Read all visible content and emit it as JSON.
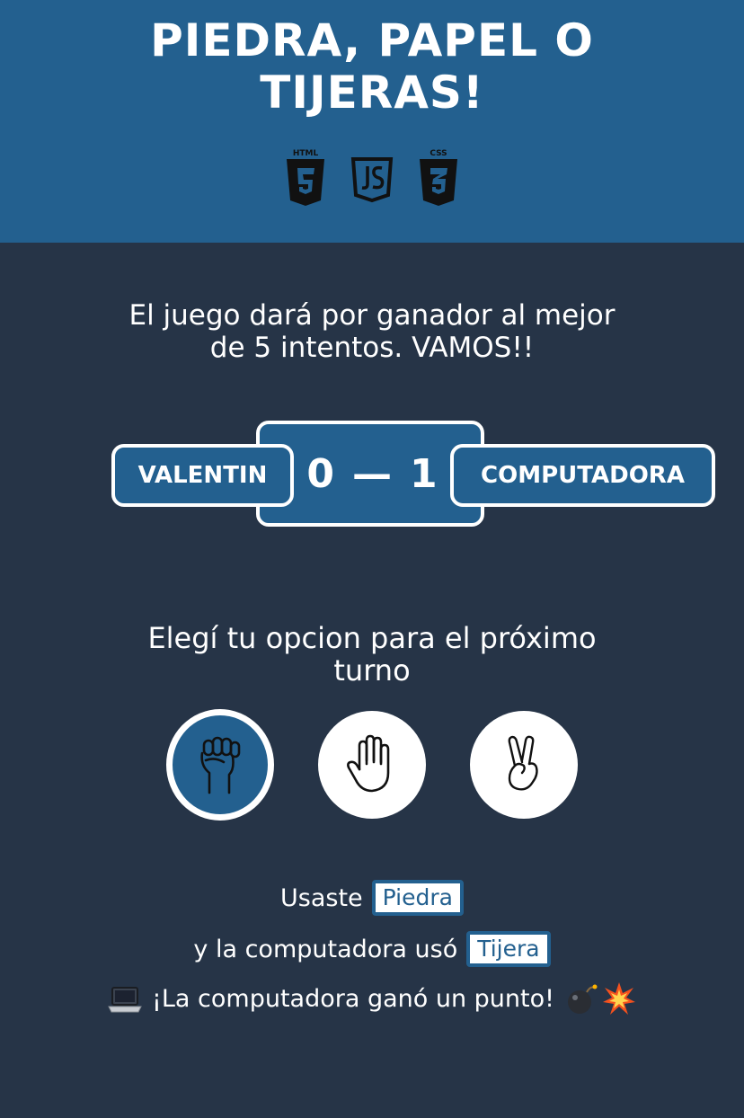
{
  "header": {
    "title_line1": "PIEDRA, PAPEL O",
    "title_line2": "TIJERAS!",
    "tech_icons": [
      "html5-icon",
      "js-icon",
      "css3-icon"
    ],
    "tech_labels": {
      "html": "HTML",
      "css": "CSS"
    },
    "background": "#23608f"
  },
  "intro": {
    "line1": "El juego dará por ganador al mejor",
    "line2": "de 5 intentos. VAMOS!!"
  },
  "scoreboard": {
    "player_name": "VALENTIN",
    "player_score": "0",
    "separator": "—",
    "computer_score": "1",
    "computer_name": "COMPUTADORA"
  },
  "prompt": {
    "line1": "Elegí tu opcion para el próximo",
    "line2": "turno"
  },
  "choices": [
    {
      "name": "rock",
      "icon": "fist-icon",
      "selected": true
    },
    {
      "name": "paper",
      "icon": "open-hand-icon",
      "selected": false
    },
    {
      "name": "scissors",
      "icon": "victory-hand-icon",
      "selected": false
    }
  ],
  "result": {
    "used_prefix": "Usaste",
    "player_choice": "Piedra",
    "computer_prefix": "y la computadora usó",
    "computer_choice": "Tijera",
    "message": "¡La computadora ganó un punto!",
    "leading_icon": "laptop-icon",
    "trailing_icons": [
      "bomb-icon",
      "collision-icon"
    ]
  },
  "colors": {
    "background": "#263447",
    "accent": "#23608f",
    "text": "#ffffff"
  }
}
